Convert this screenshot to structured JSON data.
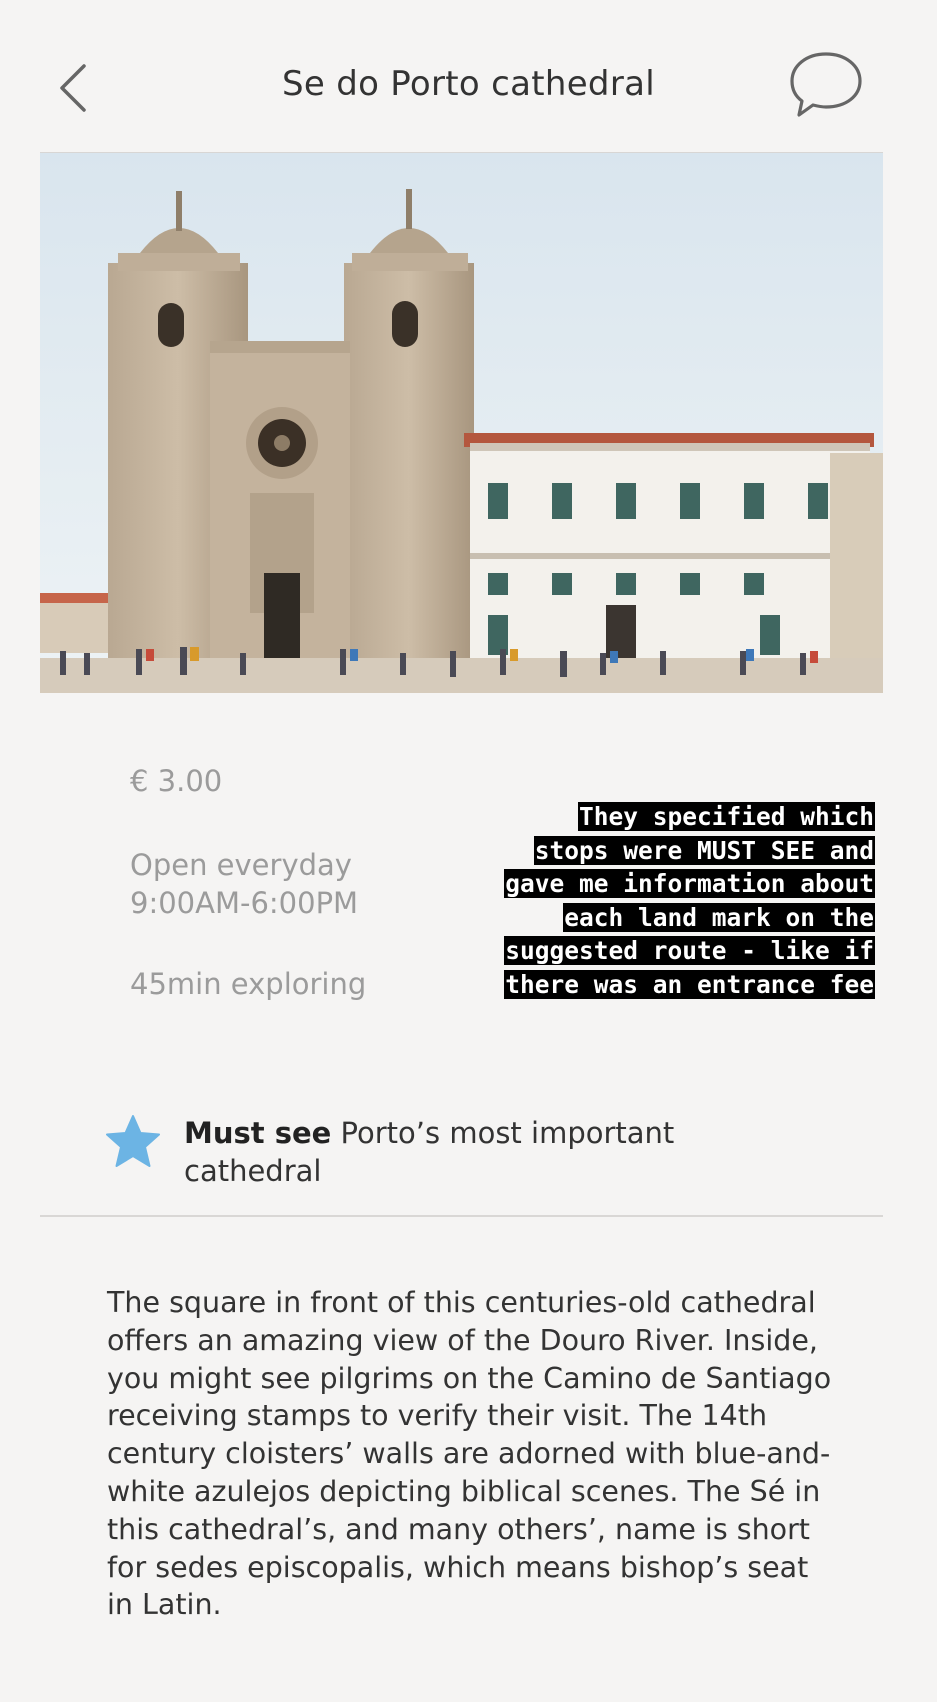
{
  "header": {
    "title": "Se do Porto cathedral",
    "back_icon": "chevron-left-icon",
    "chat_icon": "speech-bubble-icon"
  },
  "photo": {
    "subject": "cathedral-photo"
  },
  "info": {
    "price": "€ 3.00",
    "open_days": "Open everyday",
    "hours": "9:00AM-6:00PM",
    "duration": "45min exploring"
  },
  "caption": {
    "lines": [
      "They specified which",
      "stops were MUST SEE and",
      "gave me information about",
      "each land mark on the",
      "suggested route - like if",
      "there was an entrance fee"
    ]
  },
  "must_see": {
    "icon": "star-icon",
    "icon_color": "#6cb4e4",
    "label": "Must see",
    "line1": " Porto’s most important",
    "line2": "cathedral"
  },
  "description": "The square in front of this centuries-old cathedral offers an amazing view of the Douro River. Inside, you might see pilgrims on the Camino de Santiago receiving stamps to verify their visit. The 14th century cloisters’ walls are adorned with blue-and-white azulejos depicting biblical scenes. The Sé in this cathedral’s, and many others’, name is short for sedes episcopalis, which means bishop’s seat in Latin."
}
